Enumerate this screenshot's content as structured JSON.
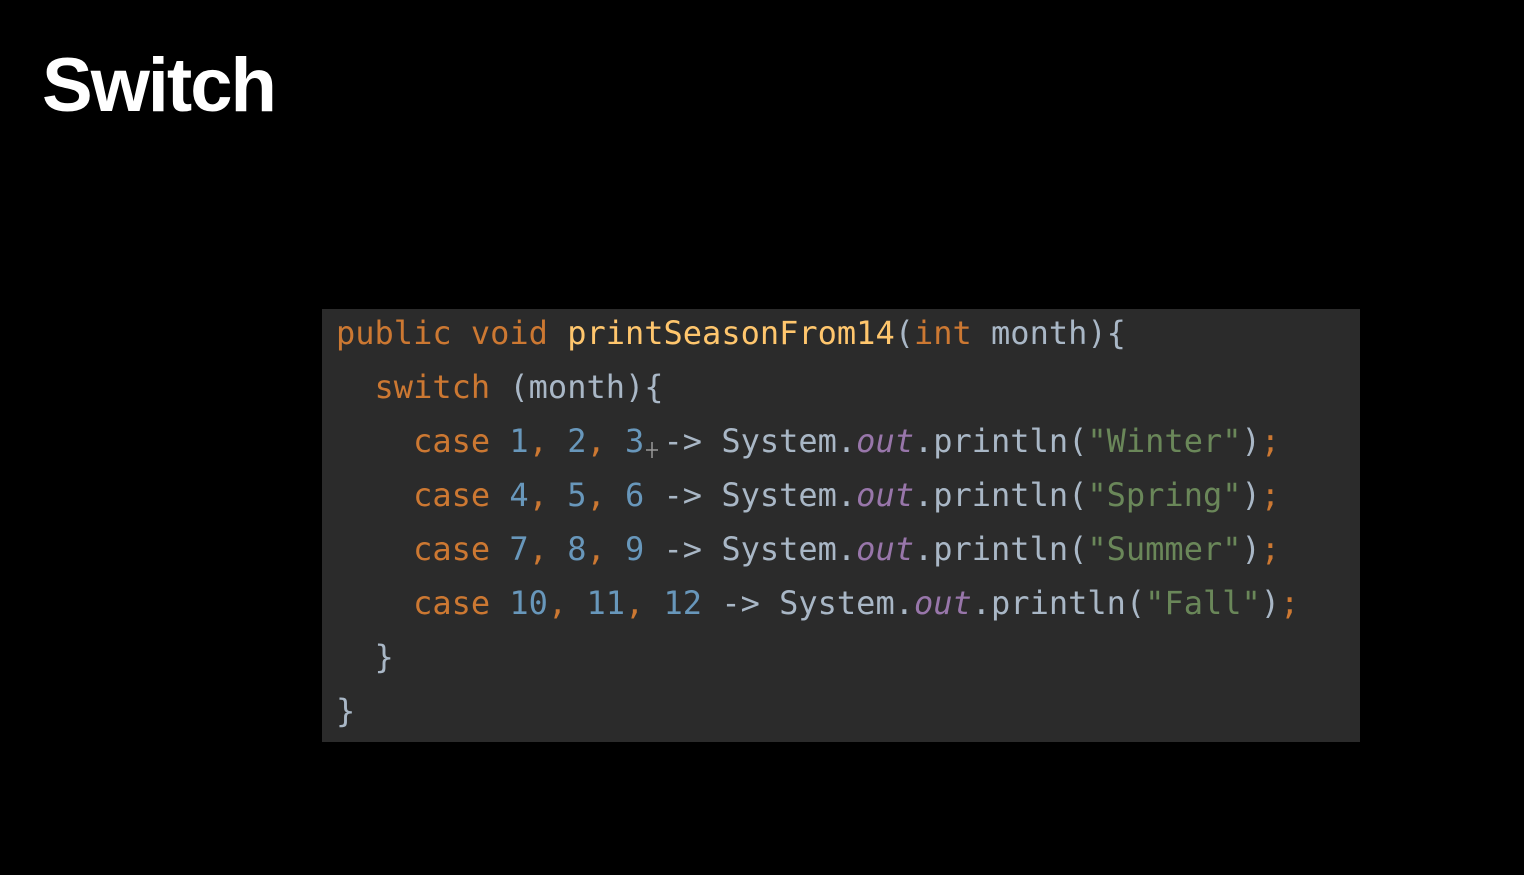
{
  "slide": {
    "title": "Switch"
  },
  "code": {
    "line1": {
      "public": "public",
      "void": "void",
      "fn_name": "printSeasonFrom14",
      "paren_open": "(",
      "int": "int",
      "param": "month",
      "close": "){"
    },
    "line2": {
      "switch": "switch",
      "expr": "(month){"
    },
    "cases": [
      {
        "case": "case",
        "n1": "1",
        "c1": ",",
        "n2": "2",
        "c2": ",",
        "n3": "3",
        "arrow": "->",
        "sys": "System",
        "dot1": ".",
        "out": "out",
        "println": ".println(",
        "str": "\"Winter\"",
        "close": ")",
        "semi": ";"
      },
      {
        "case": "case",
        "n1": "4",
        "c1": ",",
        "n2": "5",
        "c2": ",",
        "n3": "6",
        "arrow": "->",
        "sys": "System",
        "dot1": ".",
        "out": "out",
        "println": ".println(",
        "str": "\"Spring\"",
        "close": ")",
        "semi": ";"
      },
      {
        "case": "case",
        "n1": "7",
        "c1": ",",
        "n2": "8",
        "c2": ",",
        "n3": "9",
        "arrow": "->",
        "sys": "System",
        "dot1": ".",
        "out": "out",
        "println": ".println(",
        "str": "\"Summer\"",
        "close": ")",
        "semi": ";"
      },
      {
        "case": "case",
        "n1": "10",
        "c1": ",",
        "n2": "11",
        "c2": ",",
        "n3": "12",
        "arrow": "->",
        "sys": "System",
        "dot1": ".",
        "out": "out",
        "println": ".println(",
        "str": "\"Fall\"",
        "close": ")",
        "semi": ";"
      }
    ],
    "line7": "}",
    "line8": "}"
  },
  "colors": {
    "background": "#000000",
    "code_background": "#2b2b2b",
    "keyword": "#cc7832",
    "function": "#ffc66d",
    "number": "#6897bb",
    "string": "#6a8759",
    "field": "#9876aa",
    "text": "#a9b7c6"
  },
  "icons": {
    "cursor": "crosshair-cursor-icon"
  }
}
